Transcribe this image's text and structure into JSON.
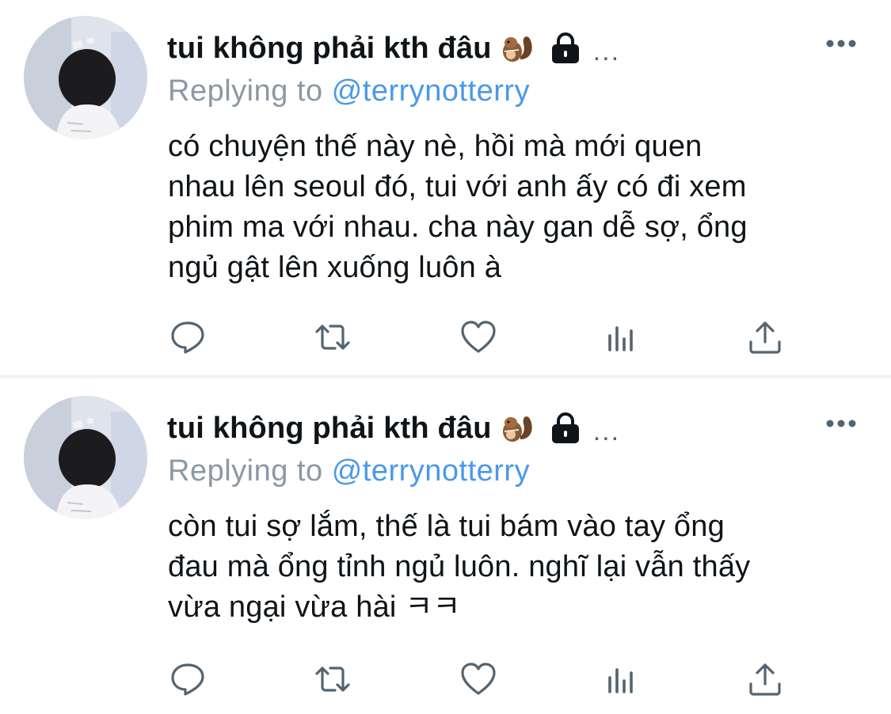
{
  "colors": {
    "text": "#0f1419",
    "secondary": "#8b98a5",
    "link": "#4a99e9",
    "icon": "#536471",
    "divider": "#eff1f3"
  },
  "tweets": [
    {
      "display_name": "tui không phải kth đâu",
      "name_emoji": "🐿",
      "name_badge_icon": "lock-icon",
      "name_overflow": "...",
      "reply_prefix": "Replying to",
      "reply_handle": "@terrynotterry",
      "text": "có chuyện thế này nè, hồi mà mới quen\nnhau lên seoul đó, tui với anh ấy có đi xem\nphim ma với nhau. cha này gan dễ sợ, ổng\nngủ gật lên xuống luôn à",
      "actions": [
        "reply-icon",
        "retweet-icon",
        "like-icon",
        "stats-icon",
        "share-icon"
      ]
    },
    {
      "display_name": "tui không phải kth đâu",
      "name_emoji": "🐿",
      "name_badge_icon": "lock-icon",
      "name_overflow": "...",
      "reply_prefix": "Replying to",
      "reply_handle": "@terrynotterry",
      "text": "còn tui sợ lắm, thế là tui bám vào tay ổng\nđau mà ổng tỉnh ngủ luôn. nghĩ lại vẫn thấy\nvừa ngại vừa hài ㅋㅋ",
      "actions": [
        "reply-icon",
        "retweet-icon",
        "like-icon",
        "stats-icon",
        "share-icon"
      ]
    }
  ]
}
